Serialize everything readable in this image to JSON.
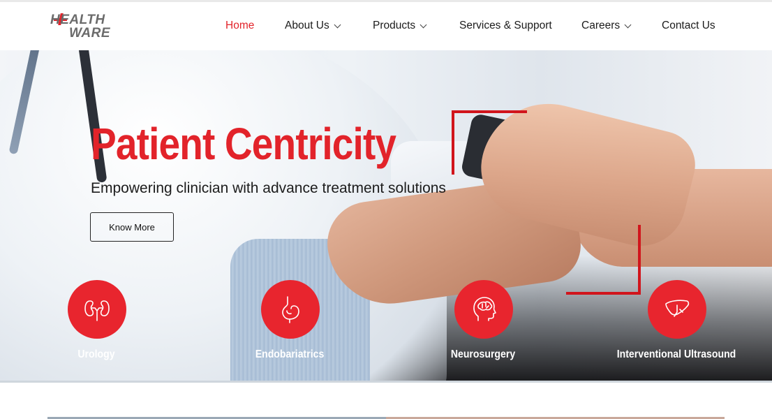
{
  "brand": {
    "line1": "HEALTH",
    "line2": "WARE",
    "accent_color": "#e2232a"
  },
  "nav": {
    "items": [
      {
        "label": "Home",
        "active": true,
        "has_dropdown": false
      },
      {
        "label": "About Us",
        "active": false,
        "has_dropdown": true
      },
      {
        "label": "Products",
        "active": false,
        "has_dropdown": true
      },
      {
        "label": "Services & Support",
        "active": false,
        "has_dropdown": false
      },
      {
        "label": "Careers",
        "active": false,
        "has_dropdown": true
      },
      {
        "label": "Contact Us",
        "active": false,
        "has_dropdown": false
      }
    ]
  },
  "hero": {
    "title": "Patient Centricity",
    "subtitle": "Empowering clinician with advance treatment solutions",
    "cta_label": "Know More"
  },
  "categories": [
    {
      "label": "Urology",
      "icon": "kidneys-icon"
    },
    {
      "label": "Endobariatrics",
      "icon": "stomach-icon"
    },
    {
      "label": "Neurosurgery",
      "icon": "brain-head-icon"
    },
    {
      "label": "Interventional Ultrasound",
      "icon": "liver-icon"
    }
  ]
}
